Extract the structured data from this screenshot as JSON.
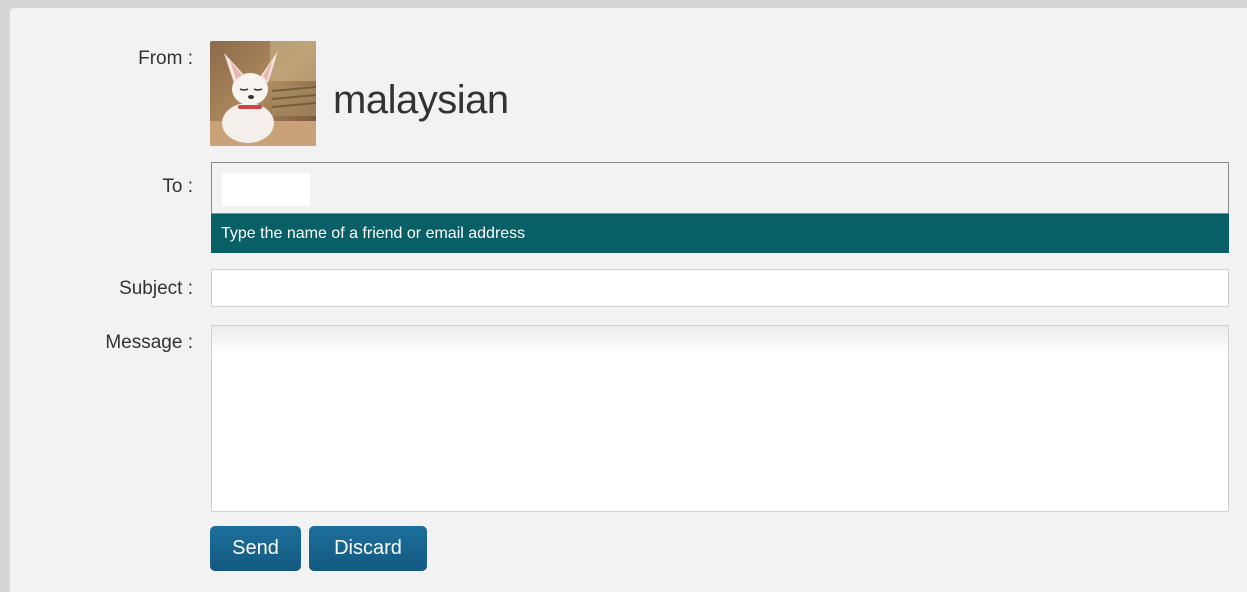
{
  "form": {
    "from_label": "From :",
    "to_label": "To :",
    "subject_label": "Subject :",
    "message_label": "Message :",
    "sender_name": "malaysian",
    "sender_avatar_icon": "dog-photo-avatar",
    "to_value": "",
    "to_hint": "Type the name of a friend or email address",
    "subject_value": "",
    "message_value": ""
  },
  "actions": {
    "send_label": "Send",
    "discard_label": "Discard"
  },
  "colors": {
    "hint_bar": "#085f66",
    "button": "#1a6690",
    "panel": "#f2f2f2",
    "page_bg": "#d6d6d6"
  }
}
